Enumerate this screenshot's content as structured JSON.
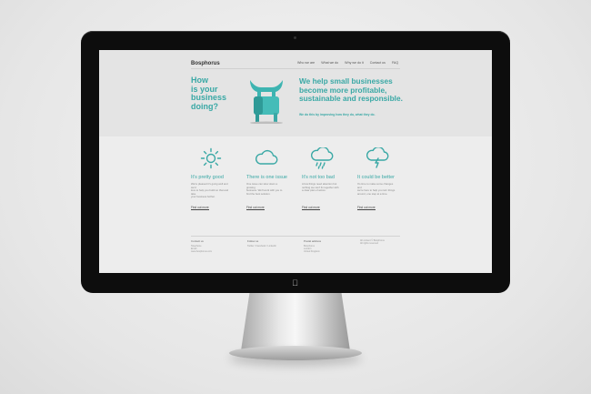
{
  "site": {
    "brand": "Bosphorus",
    "nav": [
      "Who we are",
      "What we do",
      "Why we do it",
      "Contact us",
      "FAQ"
    ],
    "hero_question": [
      "How",
      "is your",
      "business",
      "doing?"
    ],
    "headline": [
      "We help small businesses",
      "become more profitable,",
      "sustainable and responsible."
    ],
    "subline": "We do this by improving how they do, what they do."
  },
  "features": [
    {
      "icon": "sun-icon",
      "title": "It's pretty good",
      "text": [
        "We're pleased it's going well and we'd",
        "love to help you build on that and take",
        "your business further."
      ],
      "link": "Find out more"
    },
    {
      "icon": "cloud-icon",
      "title": "There is one issue",
      "text": [
        "One issue can slow down a growing",
        "business. We'll work with you to",
        "find the best solution."
      ],
      "link": "Find out more"
    },
    {
      "icon": "rain-cloud-icon",
      "title": "It's not too bad",
      "text": [
        "A few things need attention but",
        "nothing we can't fix together with",
        "a clear plan of action."
      ],
      "link": "Find out more"
    },
    {
      "icon": "storm-cloud-icon",
      "title": "It could be better",
      "text": [
        "It's time to make some changes and",
        "we're here to help you turn things",
        "around, one step at a time."
      ],
      "link": "Find out more"
    }
  ],
  "footer": [
    {
      "heading": "Contact us",
      "lines": [
        "Telephone",
        "Email",
        "www.bosphorus.com"
      ]
    },
    {
      "heading": "Follow us",
      "lines": [
        "Twitter / Facebook / LinkedIn"
      ]
    },
    {
      "heading": "Postal address",
      "lines": [
        "Bosphorus",
        "London",
        "United Kingdom"
      ]
    },
    {
      "heading": "",
      "lines": [
        "All content © Bosphorus",
        "All rights reserved"
      ]
    }
  ],
  "colors": {
    "accent": "#39a8a5",
    "bezel": "#0d0d0d",
    "screen": "#ededed"
  }
}
